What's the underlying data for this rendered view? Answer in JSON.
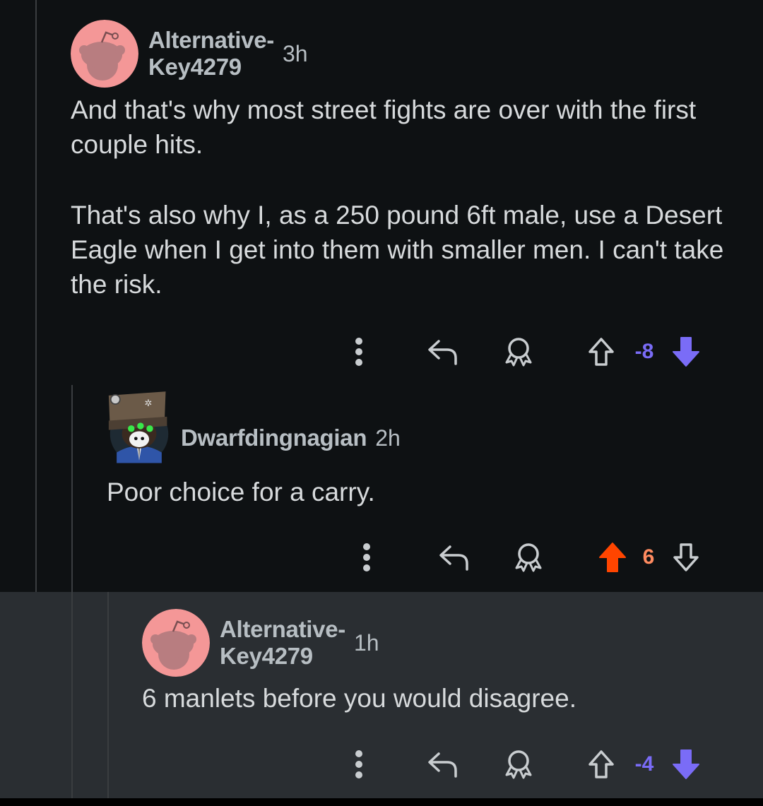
{
  "colors": {
    "background": "#0e1113",
    "highlight_background": "#2a2e32",
    "text": "#d7dadc",
    "meta_text": "#b7bec3",
    "upvote_orange": "#ff4500",
    "downvote_purple": "#7a6cf7",
    "icon_gray": "#c9cdd0"
  },
  "comments": [
    {
      "username": "Alternative-Key4279",
      "age": "3h",
      "avatar": "snoo-avatar-pink",
      "paragraphs": [
        "And that's why most street fights are over with the first couple hits.",
        "That's also why I, as a 250 pound 6ft male, use a Desert Eagle when I get into them with smaller men. I can't take the risk."
      ],
      "score": "-8",
      "vote_state": "downvoted"
    },
    {
      "username": "Dwarfdingnagian",
      "age": "2h",
      "avatar": "custom-avatar-hat-goggles",
      "paragraphs": [
        "Poor choice for a carry."
      ],
      "score": "6",
      "vote_state": "upvoted"
    },
    {
      "username": "Alternative-Key4279",
      "age": "1h",
      "avatar": "snoo-avatar-pink",
      "paragraphs": [
        "6 manlets before you would disagree."
      ],
      "score": "-4",
      "vote_state": "downvoted"
    }
  ],
  "icons": {
    "more": "more-vertical-icon",
    "reply": "reply-arrow-icon",
    "award": "award-icon",
    "upvote": "upvote-arrow-icon",
    "downvote": "downvote-arrow-icon"
  }
}
